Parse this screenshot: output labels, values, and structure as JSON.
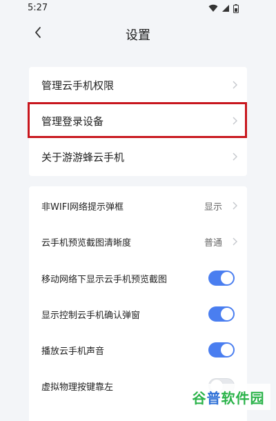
{
  "status_bar": {
    "time": "5:27",
    "icons": [
      "wifi-icon",
      "signal-icon",
      "battery-icon"
    ]
  },
  "header": {
    "back_icon": "chevron-left-icon",
    "title": "设置"
  },
  "group1": {
    "items": [
      {
        "label": "管理云手机权限"
      },
      {
        "label": "管理登录设备"
      },
      {
        "label": "关于游游蜂云手机"
      }
    ]
  },
  "group2": {
    "items": [
      {
        "label": "非WIFI网络提示弹框",
        "value": "显示"
      },
      {
        "label": "云手机预览截图清晰度",
        "value": "普通"
      },
      {
        "label": "移动网络下显示云手机预览截图",
        "toggle": true
      },
      {
        "label": "显示控制云手机确认弹窗",
        "toggle": true
      },
      {
        "label": "播放云手机声音",
        "toggle": true
      },
      {
        "label": "虚拟物理按键靠左",
        "toggle": false
      }
    ]
  },
  "watermark": {
    "part1": "谷",
    "part2": "普",
    "part3": "软件园"
  },
  "colors": {
    "accent": "#4a7ef0",
    "highlight": "#c8161d",
    "background": "#f3f5f8"
  }
}
